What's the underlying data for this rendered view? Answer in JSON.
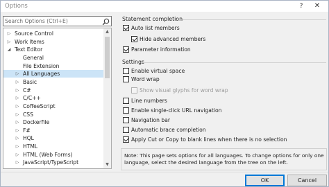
{
  "window": {
    "title": "Options",
    "close_glyph": "✕",
    "help_glyph": "?"
  },
  "search": {
    "placeholder": "Search Options (Ctrl+E)",
    "icon": "search-icon"
  },
  "tree": {
    "items": [
      {
        "label": "Source Control",
        "expander": "right"
      },
      {
        "label": "Work Items",
        "expander": "right"
      },
      {
        "label": "Text Editor",
        "expander": "down"
      },
      {
        "label": "General",
        "expander": "none"
      },
      {
        "label": "File Extension",
        "expander": "none"
      },
      {
        "label": "All Languages",
        "expander": "right",
        "selected": true
      },
      {
        "label": "Basic",
        "expander": "right"
      },
      {
        "label": "C#",
        "expander": "right"
      },
      {
        "label": "C/C++",
        "expander": "right"
      },
      {
        "label": "CoffeeScript",
        "expander": "right"
      },
      {
        "label": "CSS",
        "expander": "right"
      },
      {
        "label": "Dockerfile",
        "expander": "right"
      },
      {
        "label": "F#",
        "expander": "right"
      },
      {
        "label": "HQL",
        "expander": "right"
      },
      {
        "label": "HTML",
        "expander": "right"
      },
      {
        "label": "HTML (Web Forms)",
        "expander": "right"
      },
      {
        "label": "JavaScript/TypeScript",
        "expander": "right"
      }
    ],
    "expander_glyphs": {
      "right": "▷",
      "down": "◢"
    }
  },
  "statement_completion": {
    "heading": "Statement completion",
    "auto_list_members": {
      "label": "Auto list members",
      "checked": true
    },
    "hide_advanced_members": {
      "label": "Hide advanced members",
      "checked": true
    },
    "parameter_information": {
      "label": "Parameter information",
      "checked": true
    }
  },
  "settings": {
    "heading": "Settings",
    "enable_virtual_space": {
      "label": "Enable virtual space",
      "checked": false
    },
    "word_wrap": {
      "label": "Word wrap",
      "checked": false
    },
    "show_visual_glyphs": {
      "label": "Show visual glyphs for word wrap",
      "checked": false,
      "disabled": true
    },
    "line_numbers": {
      "label": "Line numbers",
      "checked": false
    },
    "single_click_url": {
      "label": "Enable single-click URL navigation",
      "checked": false
    },
    "navigation_bar": {
      "label": "Navigation bar",
      "checked": false
    },
    "auto_brace": {
      "label": "Automatic brace completion",
      "checked": false
    },
    "apply_cut_copy": {
      "label": "Apply Cut or Copy to blank lines when there is no selection",
      "checked": true
    }
  },
  "note": "Note: This page sets options for all languages. To change options for only one language, select the desired language from the tree on the left.",
  "buttons": {
    "ok": "OK",
    "cancel": "Cancel"
  }
}
